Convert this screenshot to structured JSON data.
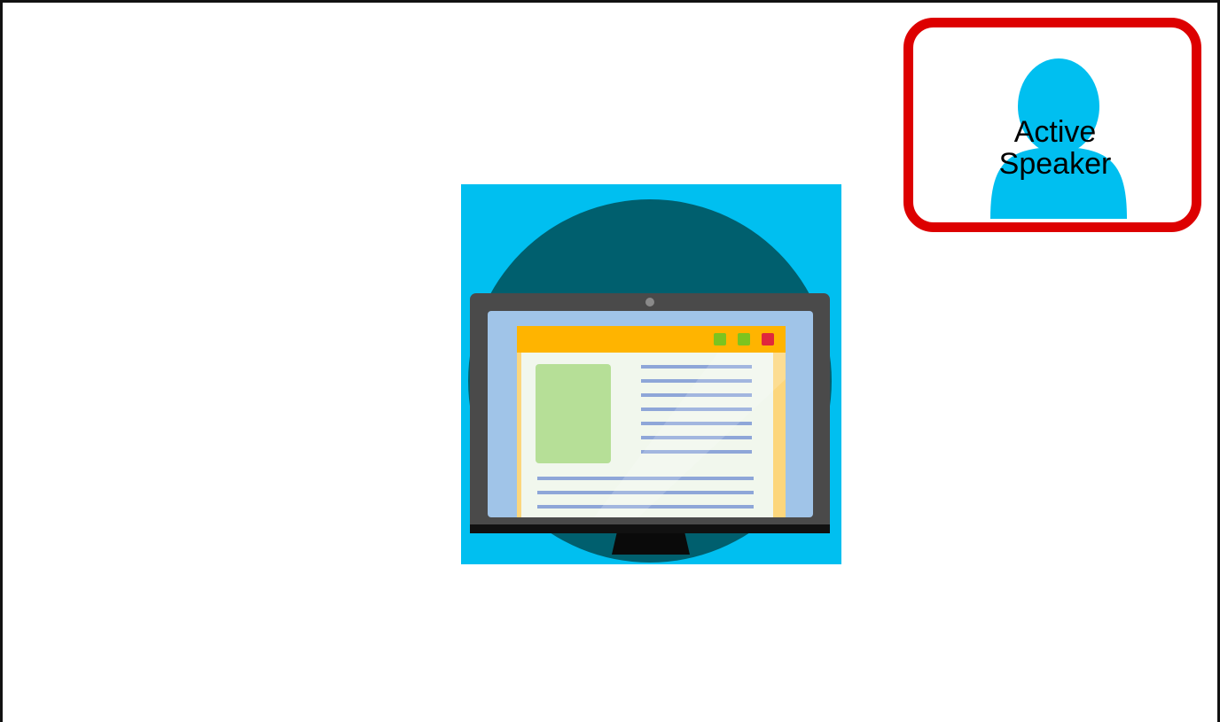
{
  "active_speaker": {
    "line1": "Active",
    "line2": "Speaker",
    "border_color": "#dd0000",
    "avatar_color": "#00bff0",
    "avatar_icon": "person-silhouette-icon"
  },
  "shared_content": {
    "icon": "computer-monitor-icon",
    "background_color": "#00bff0",
    "circle_color": "#005f6e",
    "window_title_bar_color": "#ffb400",
    "window_buttons": [
      "#7cc41f",
      "#7cc41f",
      "#e0283c"
    ]
  }
}
